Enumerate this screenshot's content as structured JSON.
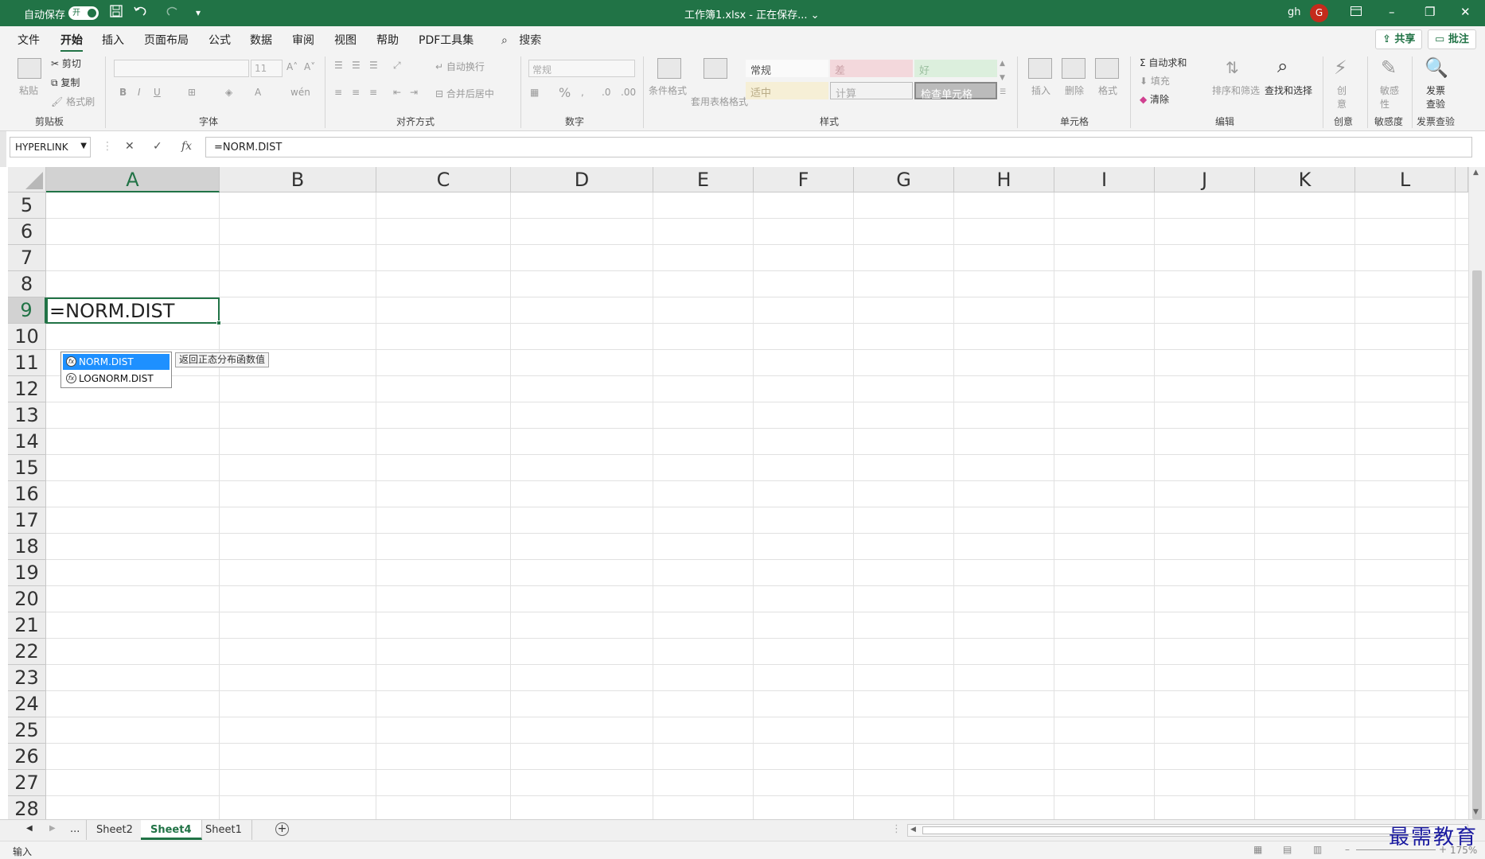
{
  "titlebar": {
    "autosave_label": "自动保存",
    "autosave_state": "开",
    "title": "工作簿1.xlsx - 正在保存... ⌄",
    "user": "gh",
    "avatar_initial": "G",
    "save_icon": "save-icon",
    "undo_icon": "undo-icon",
    "redo_icon": "redo-icon"
  },
  "menu": {
    "tabs": [
      "文件",
      "开始",
      "插入",
      "页面布局",
      "公式",
      "数据",
      "审阅",
      "视图",
      "帮助",
      "PDF工具集"
    ],
    "search": "搜索",
    "share": "共享",
    "comments": "批注"
  },
  "ribbon": {
    "clipboard": {
      "paste": "粘贴",
      "cut": "剪切",
      "copy": "复制",
      "format_painter": "格式刷",
      "label": "剪贴板"
    },
    "font": {
      "size": "11",
      "label": "字体",
      "bold": "B",
      "italic": "I",
      "underline": "U"
    },
    "alignment": {
      "wrap": "自动换行",
      "merge": "合并后居中",
      "label": "对齐方式"
    },
    "number": {
      "format": "常规",
      "percent": "%",
      "label": "数字"
    },
    "styles": {
      "conditional": "条件格式",
      "table_format": "套用表格格式",
      "normal": "常规",
      "bad": "差",
      "good": "好",
      "neutral": "适中",
      "calculation": "计算",
      "check_cell": "检查单元格",
      "label": "样式"
    },
    "cells": {
      "insert": "插入",
      "delete": "删除",
      "format": "格式",
      "label": "单元格"
    },
    "editing": {
      "autosum": "自动求和",
      "fill": "填充",
      "clear": "清除",
      "sort_filter": "排序和筛选",
      "find_select": "查找和选择",
      "label": "编辑"
    },
    "creativity": {
      "btn": "创意",
      "label": "创意"
    },
    "sensitivity": {
      "btn": "敏感性",
      "label": "敏感度"
    },
    "invoice": {
      "btn": "发票查验",
      "label": "发票查验"
    }
  },
  "formula_bar": {
    "name_box": "HYPERLINK",
    "cancel": "✕",
    "enter": "✓",
    "fx": "fx",
    "formula": "=NORM.DIST"
  },
  "grid": {
    "columns": [
      "A",
      "B",
      "C",
      "D",
      "E",
      "F",
      "G",
      "H",
      "I",
      "J",
      "K",
      "L"
    ],
    "rows": [
      "5",
      "6",
      "7",
      "8",
      "9",
      "10",
      "11",
      "12",
      "13",
      "14",
      "15",
      "16",
      "17",
      "18",
      "19",
      "20",
      "21",
      "22",
      "23",
      "24",
      "25",
      "26",
      "27",
      "28"
    ],
    "active_cell_value": "=NORM.DIST",
    "autocomplete": [
      "NORM.DIST",
      "LOGNORM.DIST"
    ],
    "tooltip": "返回正态分布函数值"
  },
  "sheets": {
    "ellipsis": "...",
    "tabs": [
      "Sheet2",
      "Sheet4",
      "Sheet1"
    ],
    "active": "Sheet4",
    "add": "+"
  },
  "status": {
    "mode": "输入",
    "zoom": "175%"
  },
  "watermark": "最需教育",
  "colors": {
    "accent": "#217346",
    "select_blue": "#1e90ff"
  }
}
